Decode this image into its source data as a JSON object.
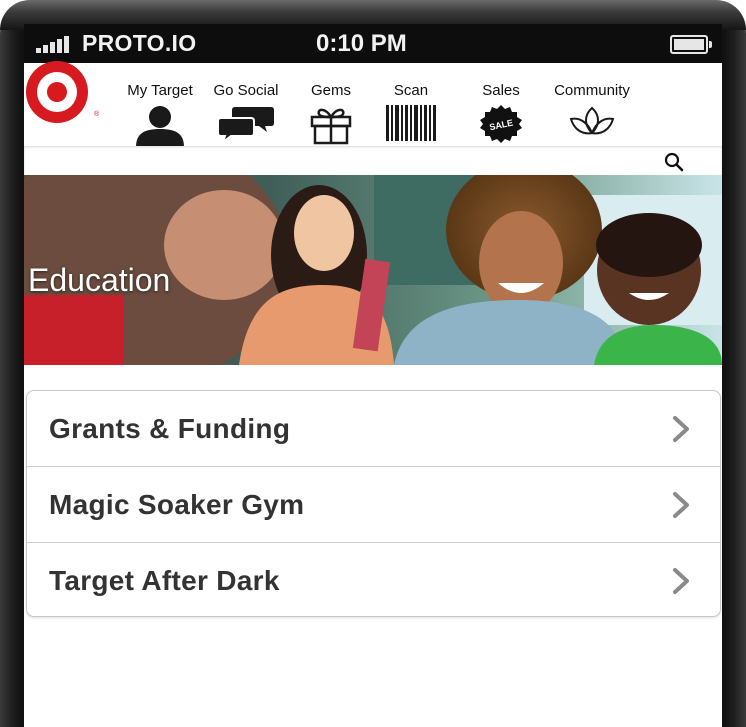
{
  "status_bar": {
    "carrier": "PROTO.IO",
    "time": "0:10 PM"
  },
  "nav": {
    "items": [
      {
        "label": "My Target",
        "icon": "person-icon"
      },
      {
        "label": "Go Social",
        "icon": "chat-bubbles-icon"
      },
      {
        "label": "Gems",
        "icon": "gift-icon"
      },
      {
        "label": "Scan",
        "icon": "barcode-icon"
      },
      {
        "label": "Sales",
        "icon": "sale-badge-icon"
      },
      {
        "label": "Community",
        "icon": "lotus-icon"
      }
    ],
    "sale_badge_text": "SALE",
    "logo_mark": "®"
  },
  "search": {
    "value": "",
    "placeholder": "",
    "icon": "search-icon"
  },
  "banner": {
    "title": "Education"
  },
  "menu": {
    "items": [
      {
        "label": "Grants & Funding"
      },
      {
        "label": "Magic Soaker Gym"
      },
      {
        "label": "Target After Dark"
      }
    ]
  },
  "colors": {
    "brand_red": "#d61a20",
    "status_bar_bg": "#0d0d0d",
    "row_text": "#333333",
    "chevron": "#8a8a8a"
  }
}
